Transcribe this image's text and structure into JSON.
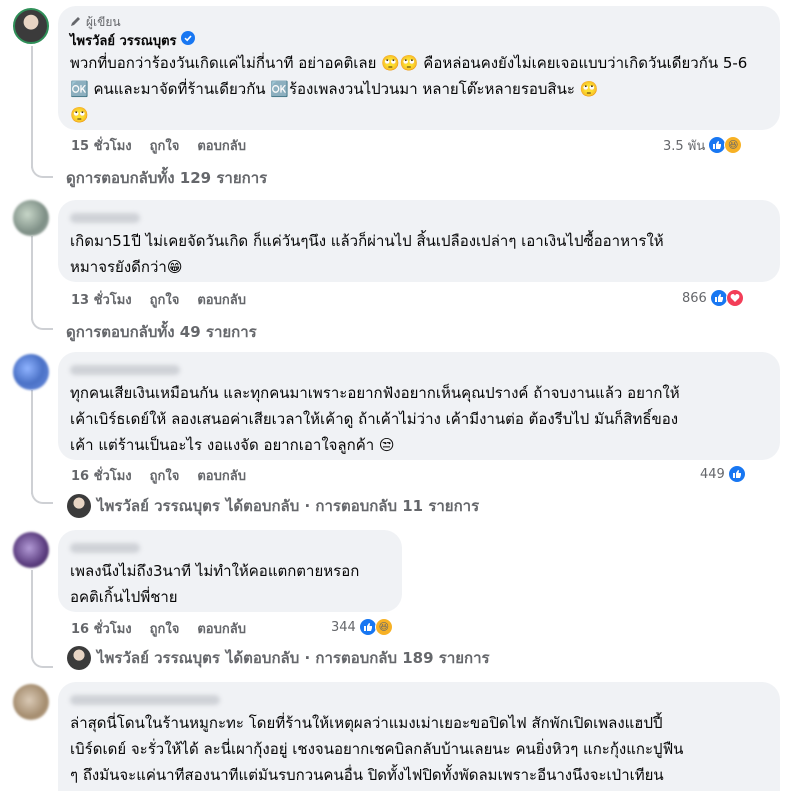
{
  "comments": [
    {
      "author_badge": "ผู้เขียน",
      "name": "ไพรวัลย์ วรรณบุตร",
      "verified": true,
      "text": "พวกที่บอกว่าร้องวันเกิดแค่ไม่กี่นาที อย่าอคติเลย 🙄🙄 คือหล่อนคงยังไม่เคยเจอแบบว่าเกิดวันเดียวกัน 5-6 🆗 คนและมาจัดที่ร้านเดียวกัน 🆗ร้องเพลงวนไปวนมา หลายโต๊ะหลายรอบสินะ 🙄\n🙄",
      "time": "15 ชั่วโมง",
      "like_label": "ถูกใจ",
      "reply_label": "ตอบกลับ",
      "reaction_count": "3.5 พัน",
      "reactions": [
        "like",
        "haha"
      ],
      "view_replies": "ดูการตอบกลับทั้ง 129 รายการ"
    },
    {
      "name": "",
      "text": "เกิดมา51ปี ไม่เคยจัดวันเกิด ก็แค่วันๆนึง แล้วก็ผ่านไป สิ้นเปลืองเปล่าๆ เอาเงินไปซื้ออาหารให้\nหมาจรยังดีกว่า😁",
      "time": "13 ชั่วโมง",
      "like_label": "ถูกใจ",
      "reply_label": "ตอบกลับ",
      "reaction_count": "866",
      "reactions": [
        "like",
        "love"
      ],
      "view_replies": "ดูการตอบกลับทั้ง 49 รายการ"
    },
    {
      "name": "",
      "text": "ทุกคนเสียเงินเหมือนกัน และทุกคนมาเพราะอยากฟังอยากเห็นคุณปรางค์ ถ้าจบงานแล้ว อยากให้\nเค้าเบิร์ธเดย์ให้ ลองเสนอค่าเสียเวลาให้เค้าดู ถ้าเค้าไม่ว่าง เค้ามีงานต่อ ต้องรีบไป มันก็สิทธิ์ของ\nเค้า แต่ร้านเป็นอะไร งอแงจัด อยากเอาใจลูกค้า 😒",
      "time": "16 ชั่วโมง",
      "like_label": "ถูกใจ",
      "reply_label": "ตอบกลับ",
      "reaction_count": "449",
      "reactions": [
        "like"
      ],
      "reply_summary_name": "ไพรวัลย์ วรรณบุตร",
      "reply_summary_rest": "ได้ตอบกลับ · การตอบกลับ 11 รายการ"
    },
    {
      "name": "",
      "text": "เพลงนึงไม่ถึง3นาที ไม่ทำให้คอแตกตายหรอก\nอคติเกิ้นไปพี่ชาย",
      "time": "16 ชั่วโมง",
      "like_label": "ถูกใจ",
      "reply_label": "ตอบกลับ",
      "reaction_count": "344",
      "reactions": [
        "like",
        "haha"
      ],
      "reply_summary_name": "ไพรวัลย์ วรรณบุตร",
      "reply_summary_rest": "ได้ตอบกลับ · การตอบกลับ 189 รายการ"
    },
    {
      "name": "",
      "text": "ล่าสุดนี่โดนในร้านหมูกะทะ โดยที่ร้านให้เหตุผลว่าแมงเม่าเยอะขอปิดไฟ สักพักเปิดเพลงแฮปปี้\nเบิร์ดเดย์ จะรั่วให้ได้ ละนี่เผากุ้งอยู่ เชงจนอยากเชคบิลกลับบ้านเลยนะ คนยิ่งหิวๆ แกะกุ้งแกะปูฟืน\nๆ ถึงมันจะแค่นาทีสองนาทีแต่มันรบกวนคนอื่น ปิดทั้งไฟปิดทั้งพัดลมเพราะอีนางนึงจะเป่าเทียน\nโอ้โหหหห สุดจะ"
    }
  ]
}
